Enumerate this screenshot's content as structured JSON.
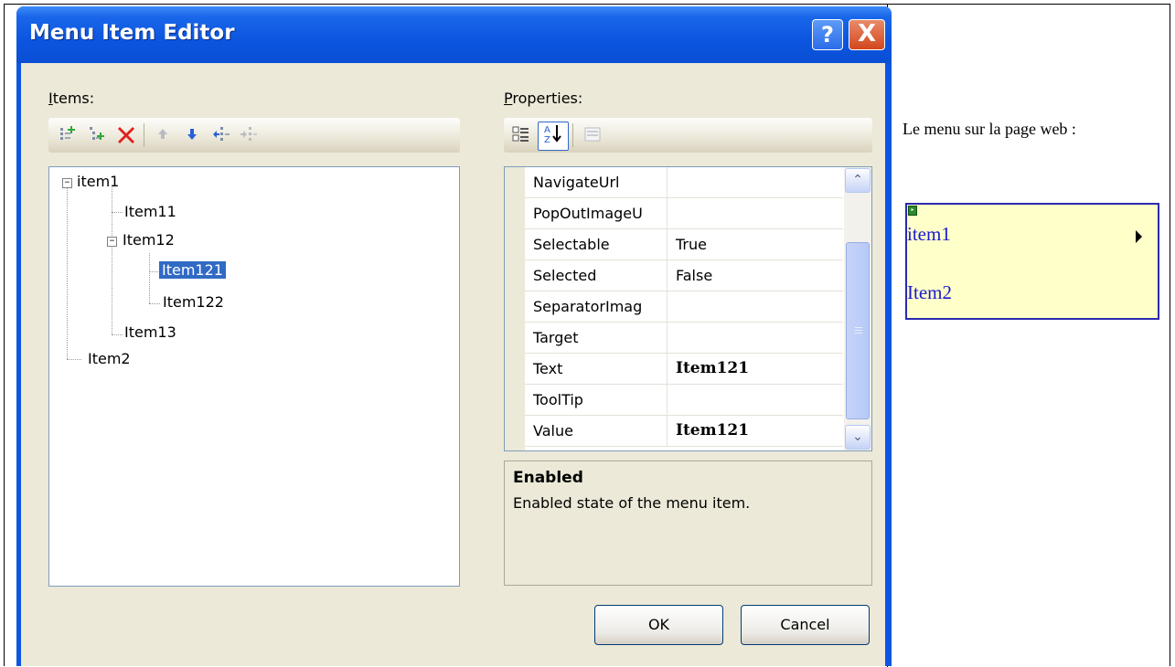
{
  "dialog": {
    "title": "Menu Item Editor",
    "help_glyph": "?",
    "close_glyph": "X"
  },
  "items_panel": {
    "label_accel": "I",
    "label_rest": "tems:",
    "tree": [
      {
        "label": "item1"
      },
      {
        "label": "Item11"
      },
      {
        "label": "Item12"
      },
      {
        "label": "Item121",
        "selected": true
      },
      {
        "label": "Item122"
      },
      {
        "label": "Item13"
      },
      {
        "label": "Item2"
      }
    ],
    "expander_glyph": "−"
  },
  "properties_panel": {
    "label_accel": "P",
    "label_rest": "roperties:",
    "rows": [
      {
        "name": "NavigateUrl",
        "value": ""
      },
      {
        "name": "PopOutImageU",
        "value": ""
      },
      {
        "name": "Selectable",
        "value": "True"
      },
      {
        "name": "Selected",
        "value": "False"
      },
      {
        "name": "SeparatorImag",
        "value": ""
      },
      {
        "name": "Target",
        "value": ""
      },
      {
        "name": "Text",
        "value": "Item121"
      },
      {
        "name": "ToolTip",
        "value": ""
      },
      {
        "name": "Value",
        "value": "Item121"
      }
    ],
    "description_title": "Enabled",
    "description_text": "Enabled state of the menu item.",
    "scroll_up_glyph": "⌃",
    "scroll_down_glyph": "⌄"
  },
  "buttons": {
    "ok": "OK",
    "cancel": "Cancel"
  },
  "side": {
    "caption": "Le menu sur la page web :",
    "menu_items": [
      "item1",
      "Item2"
    ]
  },
  "icons": {
    "add_root": "add-root-item-icon",
    "add_child": "add-child-item-icon",
    "remove": "remove-item-icon",
    "move_up": "move-up-icon",
    "move_down": "move-down-icon",
    "outdent": "outdent-icon",
    "indent": "indent-icon",
    "categorized": "categorized-icon",
    "alphabetical": "alphabetical-sort-icon",
    "property_pages": "property-pages-icon"
  },
  "colors": {
    "title_bar": "#0a56e0",
    "selection": "#316ac5",
    "remove_red": "#e0201c",
    "arrow_blue": "#2a5fd8",
    "menu_bg": "#ffffc9",
    "menu_text": "#1a1ad0"
  }
}
